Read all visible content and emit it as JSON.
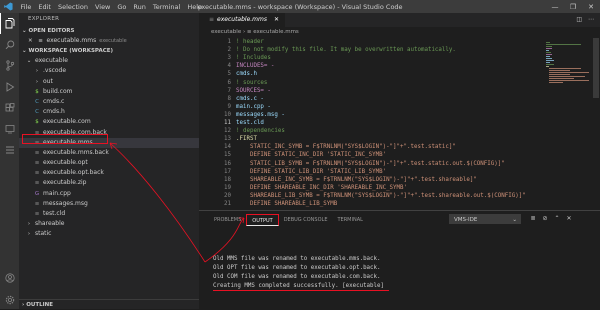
{
  "titlebar": {
    "menu": [
      "File",
      "Edit",
      "Selection",
      "View",
      "Go",
      "Run",
      "Terminal",
      "Help"
    ],
    "title": "executable.mms - workspace (Workspace) - Visual Studio Code",
    "controls": [
      "—",
      "❐",
      "✕"
    ]
  },
  "activity_icons": [
    "files-icon",
    "search-icon",
    "source-control-icon",
    "run-debug-icon",
    "extensions-icon",
    "remote-icon",
    "testing-icon"
  ],
  "sidebar": {
    "header": "EXPLORER",
    "open_editors": "OPEN EDITORS",
    "open_file": {
      "name": "executable.mms",
      "desc": "executable"
    },
    "workspace": "WORKSPACE (WORKSPACE)",
    "tree": [
      {
        "label": "executable",
        "icon": "⌄",
        "indent": 0,
        "kind": "folder"
      },
      {
        "label": ".vscode",
        "icon": "›",
        "indent": 1,
        "kind": "folder"
      },
      {
        "label": "out",
        "icon": "›",
        "indent": 1,
        "kind": "folder"
      },
      {
        "label": "build.com",
        "icon": "$",
        "indent": 1,
        "kind": "file"
      },
      {
        "label": "cmds.c",
        "icon": "C",
        "indent": 1,
        "kind": "file"
      },
      {
        "label": "cmds.h",
        "icon": "C",
        "indent": 1,
        "kind": "file"
      },
      {
        "label": "executable.com",
        "icon": "$",
        "indent": 1,
        "kind": "file"
      },
      {
        "label": "executable.com.back",
        "icon": "≡",
        "indent": 1,
        "kind": "file"
      },
      {
        "label": "executable.mms",
        "icon": "≡",
        "indent": 1,
        "kind": "file"
      },
      {
        "label": "executable.mms.back",
        "icon": "≡",
        "indent": 1,
        "kind": "file"
      },
      {
        "label": "executable.opt",
        "icon": "≡",
        "indent": 1,
        "kind": "file"
      },
      {
        "label": "executable.opt.back",
        "icon": "≡",
        "indent": 1,
        "kind": "file"
      },
      {
        "label": "executable.zip",
        "icon": "≡",
        "indent": 1,
        "kind": "file"
      },
      {
        "label": "main.cpp",
        "icon": "G",
        "indent": 1,
        "kind": "file"
      },
      {
        "label": "messages.msg",
        "icon": "≡",
        "indent": 1,
        "kind": "file"
      },
      {
        "label": "test.cld",
        "icon": "≡",
        "indent": 1,
        "kind": "file"
      },
      {
        "label": "shareable",
        "icon": "›",
        "indent": 0,
        "kind": "folder"
      },
      {
        "label": "static",
        "icon": "›",
        "indent": 0,
        "kind": "folder"
      }
    ],
    "outline": "OUTLINE"
  },
  "editor": {
    "tab": "executable.mms",
    "breadcrumb": [
      "executable",
      "›",
      "≡",
      "executable.mms"
    ],
    "current_line": 11,
    "lines": [
      {
        "n": 1,
        "t": "! header",
        "c": "comment"
      },
      {
        "n": 2,
        "t": "! Do not modify this file. It may be overwritten automatically.",
        "c": "comment"
      },
      {
        "n": 3,
        "t": "! Includes",
        "c": "comment"
      },
      {
        "n": 4,
        "t": "INCLUDES= -",
        "c": "macro"
      },
      {
        "n": 5,
        "t": "cmds.h",
        "c": "value"
      },
      {
        "n": 6,
        "t": "! sources",
        "c": "comment"
      },
      {
        "n": 7,
        "t": "SOURCES= -",
        "c": "macro"
      },
      {
        "n": 8,
        "t": "cmds.c -",
        "c": "value"
      },
      {
        "n": 9,
        "t": "main.cpp -",
        "c": "value"
      },
      {
        "n": 10,
        "t": "messages.msg -",
        "c": "value"
      },
      {
        "n": 11,
        "t": "test.cld",
        "c": "value"
      },
      {
        "n": 12,
        "t": "! dependencies",
        "c": "comment"
      },
      {
        "n": 13,
        "t": ".FIRST",
        "c": "keyword"
      },
      {
        "n": 14,
        "t": "    STATIC_INC_SYMB = F$TRNLNM(\"SYS$LOGIN\")-\"]\"+\".test.static]\"",
        "c": "string"
      },
      {
        "n": 15,
        "t": "    DEFINE STATIC_INC_DIR 'STATIC_INC_SYMB'",
        "c": "string"
      },
      {
        "n": 16,
        "t": "    STATIC_LIB_SYMB = F$TRNLNM(\"SYS$LOGIN\")-\"]\"+\".test.static.out.$(CONFIG)]\"",
        "c": "string"
      },
      {
        "n": 17,
        "t": "    DEFINE STATIC_LIB_DIR 'STATIC_LIB_SYMB'",
        "c": "string"
      },
      {
        "n": 18,
        "t": "    SHAREABLE_INC_SYMB = F$TRNLNM(\"SYS$LOGIN\")-\"]\"+\".test.shareable]\"",
        "c": "string"
      },
      {
        "n": 19,
        "t": "    DEFINE SHAREABLE_INC_DIR 'SHAREABLE_INC_SYMB'",
        "c": "string"
      },
      {
        "n": 20,
        "t": "    SHAREABLE_LIB_SYMB = F$TRNLNM(\"SYS$LOGIN\")-\"]\"+\".test.shareable.out.$(CONFIG)]\"",
        "c": "string"
      },
      {
        "n": 21,
        "t": "    DEFINE SHAREABLE_LIB_SYMB",
        "c": "string"
      }
    ]
  },
  "panel": {
    "tabs": [
      "PROBLEMS",
      "OUTPUT",
      "DEBUG CONSOLE",
      "TERMINAL"
    ],
    "active_tab": "OUTPUT",
    "channel": "VMS-IDE",
    "output": [
      "Old MMS file was renamed to executable.mms.back.",
      "Old OPT file was renamed to executable.opt.back.",
      "Old COM file was renamed to executable.com.back.",
      "Creating MMS completed successfully. [executable]"
    ]
  },
  "colors": {
    "comment": "#6a9955",
    "macro": "#c586c0",
    "value": "#9cdcfe",
    "keyword": "#dcdcaa",
    "string": "#ce9178",
    "annotation": "#e81123"
  }
}
